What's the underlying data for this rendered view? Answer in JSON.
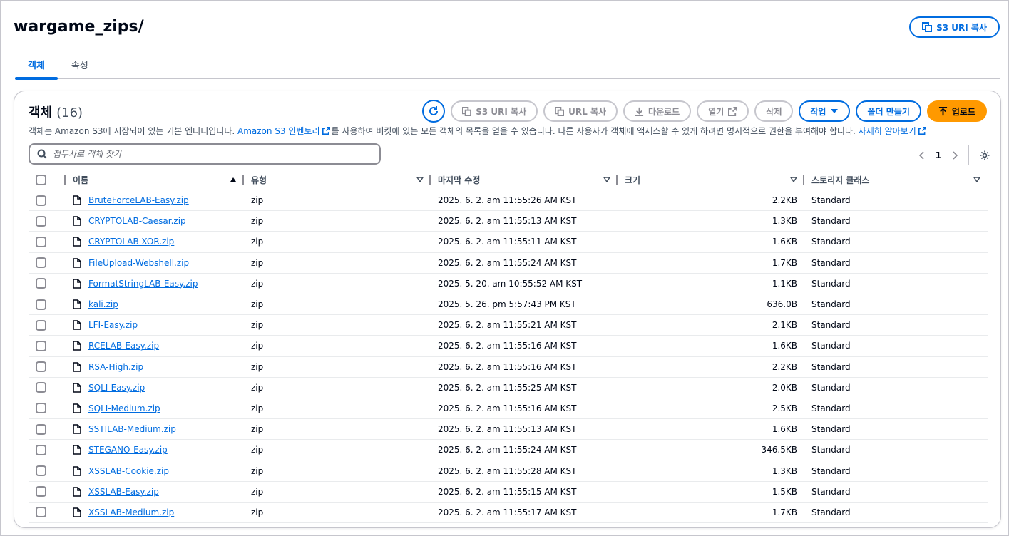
{
  "header": {
    "title": "wargame_zips/",
    "copy_uri_label": "S3 URI 복사"
  },
  "tabs": [
    {
      "label": "객체",
      "active": true
    },
    {
      "label": "속성",
      "active": false
    }
  ],
  "panel": {
    "heading": "객체",
    "count": "(16)",
    "description": {
      "part1": "객체는 Amazon S3에 저장되어 있는 기본 엔터티입니다. ",
      "link1": "Amazon S3 인벤토리",
      "part2": "를 사용하여 버킷에 있는 모든 객체의 목록을 얻을 수 있습니다. 다른 사용자가 객체에 액세스할 수 있게 하려면 명시적으로 권한을 부여해야 합니다. ",
      "link2": "자세히 알아보기"
    },
    "actions": {
      "copy_s3_uri": "S3 URI 복사",
      "copy_url": "URL 복사",
      "download": "다운로드",
      "open": "열기",
      "delete": "삭제",
      "actions": "작업",
      "create_folder": "폴더 만들기",
      "upload": "업로드"
    },
    "search": {
      "placeholder": "접두사로 객체 찾기",
      "value": ""
    },
    "pagination": {
      "current_page": "1"
    },
    "columns": {
      "name": "이름",
      "type": "유형",
      "modified": "마지막 수정",
      "size": "크기",
      "storage_class": "스토리지 클래스"
    },
    "rows": [
      {
        "name": "BruteForceLAB-Easy.zip",
        "type": "zip",
        "modified": "2025. 6. 2. am 11:55:26 AM KST",
        "size": "2.2KB",
        "storage": "Standard"
      },
      {
        "name": "CRYPTOLAB-Caesar.zip",
        "type": "zip",
        "modified": "2025. 6. 2. am 11:55:13 AM KST",
        "size": "1.3KB",
        "storage": "Standard"
      },
      {
        "name": "CRYPTOLAB-XOR.zip",
        "type": "zip",
        "modified": "2025. 6. 2. am 11:55:11 AM KST",
        "size": "1.6KB",
        "storage": "Standard"
      },
      {
        "name": "FileUpload-Webshell.zip",
        "type": "zip",
        "modified": "2025. 6. 2. am 11:55:24 AM KST",
        "size": "1.7KB",
        "storage": "Standard"
      },
      {
        "name": "FormatStringLAB-Easy.zip",
        "type": "zip",
        "modified": "2025. 5. 20. am 10:55:52 AM KST",
        "size": "1.1KB",
        "storage": "Standard"
      },
      {
        "name": "kali.zip",
        "type": "zip",
        "modified": "2025. 5. 26. pm 5:57:43 PM KST",
        "size": "636.0B",
        "storage": "Standard"
      },
      {
        "name": "LFI-Easy.zip",
        "type": "zip",
        "modified": "2025. 6. 2. am 11:55:21 AM KST",
        "size": "2.1KB",
        "storage": "Standard"
      },
      {
        "name": "RCELAB-Easy.zip",
        "type": "zip",
        "modified": "2025. 6. 2. am 11:55:16 AM KST",
        "size": "1.6KB",
        "storage": "Standard"
      },
      {
        "name": "RSA-High.zip",
        "type": "zip",
        "modified": "2025. 6. 2. am 11:55:16 AM KST",
        "size": "2.2KB",
        "storage": "Standard"
      },
      {
        "name": "SQLI-Easy.zip",
        "type": "zip",
        "modified": "2025. 6. 2. am 11:55:25 AM KST",
        "size": "2.0KB",
        "storage": "Standard"
      },
      {
        "name": "SQLI-Medium.zip",
        "type": "zip",
        "modified": "2025. 6. 2. am 11:55:16 AM KST",
        "size": "2.5KB",
        "storage": "Standard"
      },
      {
        "name": "SSTILAB-Medium.zip",
        "type": "zip",
        "modified": "2025. 6. 2. am 11:55:13 AM KST",
        "size": "1.6KB",
        "storage": "Standard"
      },
      {
        "name": "STEGANO-Easy.zip",
        "type": "zip",
        "modified": "2025. 6. 2. am 11:55:24 AM KST",
        "size": "346.5KB",
        "storage": "Standard"
      },
      {
        "name": "XSSLAB-Cookie.zip",
        "type": "zip",
        "modified": "2025. 6. 2. am 11:55:28 AM KST",
        "size": "1.3KB",
        "storage": "Standard"
      },
      {
        "name": "XSSLAB-Easy.zip",
        "type": "zip",
        "modified": "2025. 6. 2. am 11:55:15 AM KST",
        "size": "1.5KB",
        "storage": "Standard"
      },
      {
        "name": "XSSLAB-Medium.zip",
        "type": "zip",
        "modified": "2025. 6. 2. am 11:55:17 AM KST",
        "size": "1.7KB",
        "storage": "Standard"
      }
    ]
  },
  "colors": {
    "accent": "#006ce0",
    "primary_button": "#ff9900",
    "border": "#c6c6cd",
    "text": "#000716"
  },
  "icons": [
    "copy-icon",
    "refresh-icon",
    "download-icon",
    "external-link-icon",
    "caret-down-icon",
    "upload-icon",
    "search-icon",
    "chevron-left-icon",
    "chevron-right-icon",
    "gear-icon",
    "file-icon",
    "sort-ascending-icon"
  ]
}
